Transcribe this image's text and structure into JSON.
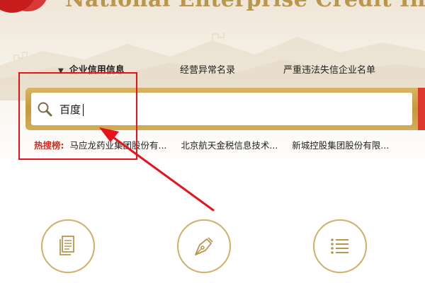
{
  "header": {
    "brand_title": "National Enterprise Credit Information P"
  },
  "tabs": [
    {
      "label": "企业信用信息",
      "active": true,
      "caret": "▼"
    },
    {
      "label": "经营异常名录",
      "active": false
    },
    {
      "label": "严重违法失信企业名单",
      "active": false
    }
  ],
  "search": {
    "value": "百度",
    "icon": "search-icon"
  },
  "hot_search": {
    "label": "热搜榜:",
    "items": [
      "马应龙药业集团股份有...",
      "北京航天金税信息技术...",
      "新城控股集团股份有限..."
    ]
  },
  "features": [
    {
      "icon": "document-icon"
    },
    {
      "icon": "pen-nib-icon"
    },
    {
      "icon": "list-icon"
    }
  ],
  "colors": {
    "accent_gold": "#c49a3a",
    "annotation_red": "#e8121b",
    "hot_label_red": "#d42b1e"
  }
}
